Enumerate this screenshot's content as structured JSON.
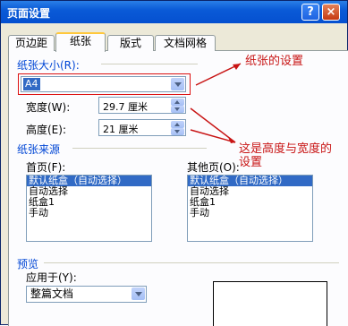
{
  "window": {
    "title": "页面设置",
    "help_label": "?",
    "close_label": "×"
  },
  "tabs": [
    {
      "label": "页边距",
      "active": false
    },
    {
      "label": "纸张",
      "active": true
    },
    {
      "label": "版式",
      "active": false
    },
    {
      "label": "文档网格",
      "active": false
    }
  ],
  "paper_size": {
    "group_label": "纸张大小(R):",
    "selected": "A4",
    "width_label": "宽度(W):",
    "width_value": "29.7 厘米",
    "height_label": "高度(E):",
    "height_value": "21 厘米"
  },
  "paper_source": {
    "group_label": "纸张来源",
    "first_page_label": "首页(F):",
    "other_pages_label": "其他页(O):",
    "first_page_items": [
      "默认纸盒（自动选择）",
      "自动选择",
      "纸盒1",
      "手动"
    ],
    "other_pages_items": [
      "默认纸盒（自动选择）",
      "自动选择",
      "纸盒1",
      "手动"
    ]
  },
  "preview": {
    "group_label": "预览",
    "apply_to_label": "应用于(Y):",
    "apply_to_value": "整篇文档"
  },
  "annotations": {
    "paper_settings": "纸张的设置",
    "height_width_line1": "这是高度与宽度的",
    "height_width_line2": "设置"
  },
  "colors": {
    "accent": "#316ac5",
    "annotation_red": "#c81414",
    "group_label_blue": "#0046d5"
  }
}
